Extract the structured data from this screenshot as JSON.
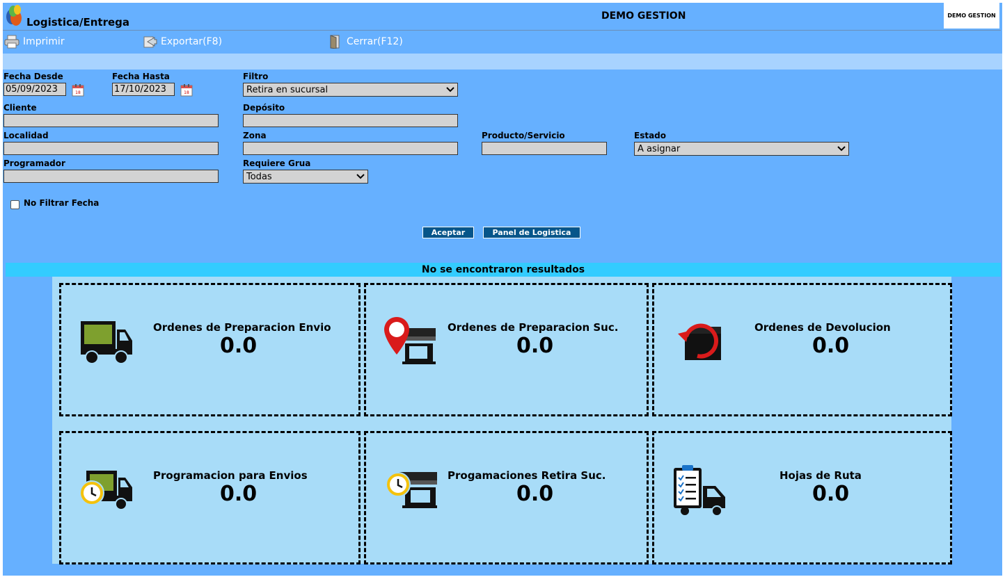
{
  "header": {
    "app_title": "Logistica/Entrega",
    "company": "DEMO GESTION",
    "brand": "DEMO GESTION"
  },
  "toolbar": {
    "print": "Imprimir",
    "export": "Exportar(F8)",
    "close": "Cerrar(F12)"
  },
  "form": {
    "fecha_desde": {
      "label": "Fecha Desde",
      "value": "05/09/2023"
    },
    "fecha_hasta": {
      "label": "Fecha Hasta",
      "value": "17/10/2023"
    },
    "filtro": {
      "label": "Filtro",
      "value": "Retira en sucursal"
    },
    "cliente": {
      "label": "Cliente",
      "value": ""
    },
    "deposito": {
      "label": "Depósito",
      "value": ""
    },
    "localidad": {
      "label": "Localidad",
      "value": ""
    },
    "zona": {
      "label": "Zona",
      "value": ""
    },
    "producto": {
      "label": "Producto/Servicio",
      "value": ""
    },
    "estado": {
      "label": "Estado",
      "value": "A asignar"
    },
    "programador": {
      "label": "Programador",
      "value": ""
    },
    "requiere_grua": {
      "label": "Requiere Grua",
      "value": "Todas"
    },
    "no_filtrar_fecha": {
      "label": "No Filtrar Fecha",
      "checked": false
    }
  },
  "buttons": {
    "aceptar": "Aceptar",
    "panel": "Panel de Logistica"
  },
  "result_message": "No se encontraron resultados",
  "cards": [
    {
      "title": "Ordenes de Preparacion Envio",
      "value": "0.0",
      "icon": "truck-icon"
    },
    {
      "title": "Ordenes de Preparacion Suc.",
      "value": "0.0",
      "icon": "store-location-icon"
    },
    {
      "title": "Ordenes de Devolucion",
      "value": "0.0",
      "icon": "return-box-icon"
    },
    {
      "title": "Programacion para Envios",
      "value": "0.0",
      "icon": "truck-clock-icon"
    },
    {
      "title": "Progamaciones Retira Suc.",
      "value": "0.0",
      "icon": "store-clock-icon"
    },
    {
      "title": "Hojas de Ruta",
      "value": "0.0",
      "icon": "clipboard-truck-icon"
    }
  ],
  "colors": {
    "background": "#66b0ff",
    "panel": "#a8dcf8",
    "result_bar": "#33ccff",
    "button": "#05558a"
  }
}
